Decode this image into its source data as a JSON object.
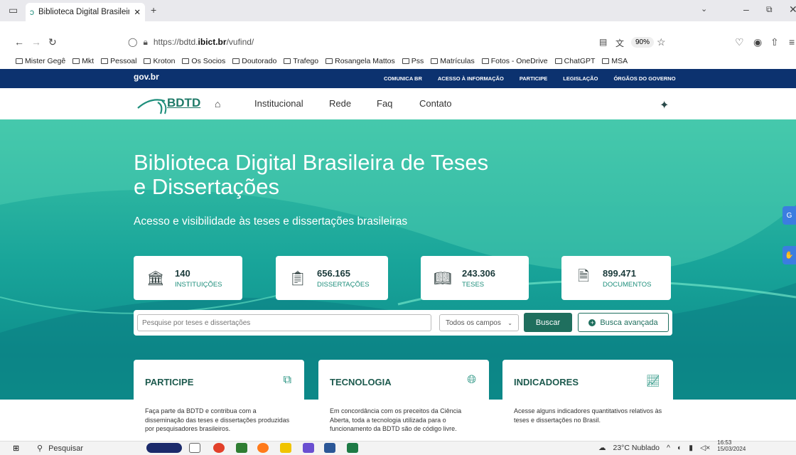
{
  "browser": {
    "tab_title": "Biblioteca Digital Brasileira",
    "url_prefix": "https://bdtd.",
    "url_domain": "ibict.br",
    "url_suffix": "/vufind/",
    "zoom": "90%",
    "bookmarks": [
      "Mister Gegê",
      "Mkt",
      "Pessoal",
      "Kroton",
      "Os Socios",
      "Doutorado",
      "Trafego",
      "Rosangela Mattos",
      "Pss",
      "Matrículas",
      "Fotos - OneDrive",
      "ChatGPT",
      "MSA"
    ]
  },
  "govbar": {
    "logo": "gov.br",
    "links": [
      "COMUNICA BR",
      "ACESSO À INFORMAÇÃO",
      "PARTICIPE",
      "LEGISLAÇÃO",
      "ÓRGÃOS DO GOVERNO"
    ]
  },
  "header": {
    "logo_text": "BDTD",
    "nav": [
      "Institucional",
      "Rede",
      "Faq",
      "Contato"
    ]
  },
  "hero": {
    "title": "Biblioteca Digital Brasileira de Teses e Dissertações",
    "subtitle": "Acesso e visibilidade às teses e dissertações brasileiras"
  },
  "stats": [
    {
      "value": "140",
      "label": "INSTITUIÇÕES",
      "icon": "institution-icon"
    },
    {
      "value": "656.165",
      "label": "DISSERTAÇÕES",
      "icon": "clipboard-icon"
    },
    {
      "value": "243.306",
      "label": "TESES",
      "icon": "book-icon"
    },
    {
      "value": "899.471",
      "label": "DOCUMENTOS",
      "icon": "document-icon"
    }
  ],
  "search": {
    "placeholder": "Pesquise por teses e dissertações",
    "field_select": "Todos os campos",
    "button": "Buscar",
    "advanced": "Busca avançada"
  },
  "cards": [
    {
      "title": "PARTICIPE",
      "body": "Faça parte da BDTD e contribua com a disseminação das teses e dissertações produzidas por pesquisadores brasileiros."
    },
    {
      "title": "TECNOLOGIA",
      "body": "Em concordância com os preceitos da Ciência Aberta, toda a tecnologia utilizada para o funcionamento da BDTD são de código livre."
    },
    {
      "title": "INDICADORES",
      "body": "Acesse alguns indicadores quantitativos relativos às teses e dissertações no Brasil."
    }
  ],
  "taskbar": {
    "search": "Pesquisar",
    "weather": "23°C Nublado",
    "time": "16:53",
    "date": "15/03/2024"
  }
}
